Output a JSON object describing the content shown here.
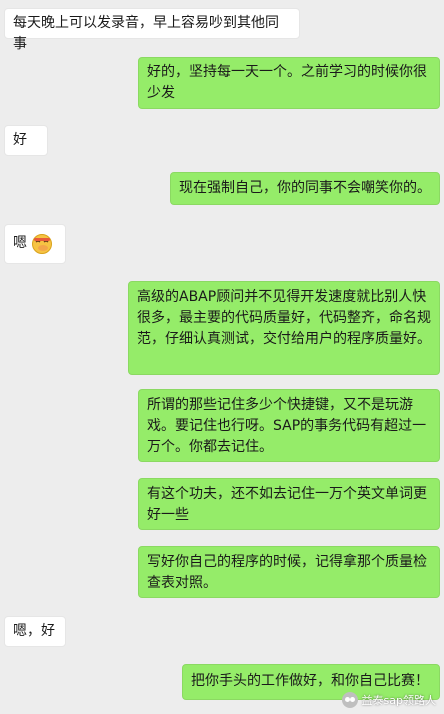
{
  "messages": [
    {
      "side": "in",
      "text": "每天晚上可以发录音，早上容易吵到其他同事"
    },
    {
      "side": "out",
      "text": "好的，坚持每一天一个。之前学习的时候你很少发"
    },
    {
      "side": "in",
      "text": "好"
    },
    {
      "side": "out",
      "text": "现在强制自己，你的同事不会嘲笑你的。"
    },
    {
      "side": "in",
      "text": "嗯",
      "emoji": "face-with-hand-over-mouth-icon"
    },
    {
      "side": "out",
      "text": "高级的ABAP顾问并不见得开发速度就比别人快很多，最主要的代码质量好，代码整齐，命名规范，仔细认真测试，交付给用户的程序质量好。"
    },
    {
      "side": "out",
      "text": "所谓的那些记住多少个快捷键，又不是玩游戏。要记住也行呀。SAP的事务代码有超过一万个。你都去记住。"
    },
    {
      "side": "out",
      "text": "有这个功夫，还不如去记住一万个英文单词更好一些"
    },
    {
      "side": "out",
      "text": "写好你自己的程序的时候，记得拿那个质量检查表对照。"
    },
    {
      "side": "in",
      "text": "嗯，好"
    },
    {
      "side": "out",
      "text": "把你手头的工作做好，和你自己比赛！"
    }
  ],
  "watermark": {
    "text": "益泰sap领路人",
    "icon": "wechat-icon"
  }
}
